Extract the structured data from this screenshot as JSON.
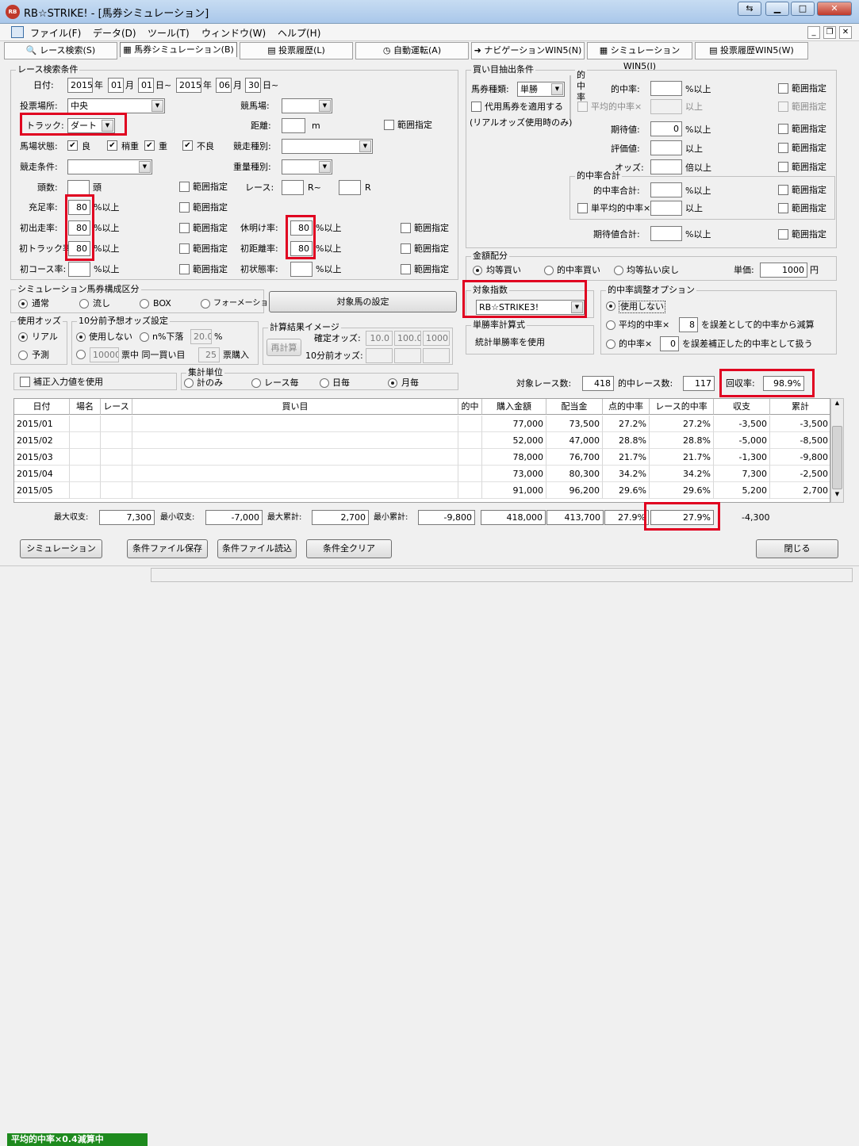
{
  "window": {
    "title": "RB☆STRIKE! - [馬券シミュレーション]",
    "app_icon": "RB"
  },
  "menu": [
    "ファイル(F)",
    "データ(D)",
    "ツール(T)",
    "ウィンドウ(W)",
    "ヘルプ(H)"
  ],
  "tabs": [
    "レース検索(S)",
    "馬券シミュレーション(B)",
    "投票履歴(L)",
    "自動運転(A)",
    "ナビゲーションWIN5(N)",
    "シミュレーションWIN5(I)",
    "投票履歴WIN5(W)"
  ],
  "race": {
    "group_title": "レース検索条件",
    "date_label": "日付:",
    "from_year": "2015",
    "year_u": "年",
    "from_month": "01",
    "month_u": "月",
    "from_day": "01",
    "day_u": "日~",
    "to_year": "2015",
    "to_month": "06",
    "to_day": "30",
    "venue_label": "投票場所:",
    "venue": "中央",
    "keibajo_label": "競馬場:",
    "track_label": "トラック:",
    "track": "ダート",
    "distance_label": "距離:",
    "distance_unit": "m",
    "range": "範囲指定",
    "baba_label": "馬場状態:",
    "baba_items": [
      "良",
      "稍重",
      "重",
      "不良"
    ],
    "shubetsu_label": "競走種別:",
    "jouken_label": "競走条件:",
    "juryo_label": "重量種別:",
    "tosu_label": "頭数:",
    "tosu_unit": "頭",
    "race_label": "レース:",
    "race_from_unit": "R~",
    "race_to_unit": "R",
    "rows": [
      {
        "label": "充足率:",
        "value": "80",
        "unit": "%以上"
      },
      {
        "label": "初出走率:",
        "value": "80",
        "unit": "%以上"
      },
      {
        "label": "初トラック率:",
        "value": "80",
        "unit": "%以上"
      },
      {
        "label": "初コース率:",
        "value": "",
        "unit": "%以上"
      }
    ],
    "rows2": [
      {
        "label": "休明け率:",
        "value": "80",
        "unit": "%以上"
      },
      {
        "label": "初距離率:",
        "value": "80",
        "unit": "%以上"
      },
      {
        "label": "初状態率:",
        "value": "",
        "unit": "%以上"
      }
    ]
  },
  "buy": {
    "group_title": "買い目抽出条件",
    "type_label": "馬券種類:",
    "type": "単勝",
    "daiyo": "代用馬券を適用する",
    "daiyo_note": "(リアルオッズ使用時のみ)",
    "hit_group": "的中率",
    "hit_label": "的中率:",
    "hit_unit": "%以上",
    "avg_hit_label": "平均的中率×",
    "avg_hit_unit": "以上",
    "exp_label": "期待値:",
    "exp_value": "0",
    "exp_unit": "%以上",
    "eval_label": "評価値:",
    "eval_unit": "以上",
    "odds_label": "オッズ:",
    "odds_unit": "倍以上",
    "sum_group": "的中率合計",
    "sum_label": "的中率合計:",
    "sum_unit": "%以上",
    "single_avg_label": "単平均的中率×",
    "single_avg_unit": "以上",
    "exp_sum_label": "期待値合計:",
    "exp_sum_unit": "%以上",
    "range": "範囲指定"
  },
  "money": {
    "group_title": "金額配分",
    "opts": [
      "均等買い",
      "的中率買い",
      "均等払い戻し"
    ],
    "unit_label": "単価:",
    "unit_value": "1000",
    "unit_yen": "円"
  },
  "sim": {
    "group_title": "シミュレーション馬券構成区分",
    "opts": [
      "通常",
      "流し",
      "BOX",
      "フォーメーション"
    ],
    "target_btn": "対象馬の設定"
  },
  "odds": {
    "group_title": "使用オッズ",
    "opts": [
      "リアル",
      "予測"
    ]
  },
  "pre10": {
    "group_title": "10分前予想オッズ設定",
    "not_use": "使用しない",
    "drop": "n%下落",
    "drop_value": "20.0",
    "drop_unit": "%",
    "ticket_value": "10000",
    "ticket_text": "票中 同一買い目",
    "buy_value": "25",
    "buy_unit": "票購入"
  },
  "calc_img": {
    "group_title": "計算結果イメージ",
    "recalc": "再計算",
    "fixed_label": "確定オッズ:",
    "fixed_vals": [
      "10.0",
      "100.0",
      "1000"
    ],
    "pre_label": "10分前オッズ:"
  },
  "target_index": {
    "group_title": "対象指数",
    "value": "RB☆STRIKE3!"
  },
  "single_calc": {
    "group_title": "単勝率計算式",
    "value": "統計単勝率を使用"
  },
  "adjust": {
    "group_title": "的中率調整オプション",
    "opt1": "使用しない",
    "opt2_pre": "平均的中率×",
    "opt2_value": "8",
    "opt2_post": "を誤差として的中率から減算",
    "opt3_pre": "的中率×",
    "opt3_value": "0",
    "opt3_post": "を誤差補正した的中率として扱う"
  },
  "correction": "補正入力値を使用",
  "agg": {
    "group_title": "集計単位",
    "opts": [
      "計のみ",
      "レース毎",
      "日毎",
      "月毎"
    ]
  },
  "summary": {
    "target_label": "対象レース数:",
    "target_value": "418",
    "hit_label": "的中レース数:",
    "hit_value": "117",
    "recovery_label": "回収率:",
    "recovery_value": "98.9%"
  },
  "table": {
    "headers": [
      "日付",
      "場名",
      "レース",
      "買い目",
      "的中",
      "購入金額",
      "配当金",
      "点的中率",
      "レース的中率",
      "収支",
      "累計"
    ],
    "rows": [
      [
        "2015/01",
        "",
        "",
        "",
        "",
        "77,000",
        "73,500",
        "27.2%",
        "27.2%",
        "-3,500",
        "-3,500"
      ],
      [
        "2015/02",
        "",
        "",
        "",
        "",
        "52,000",
        "47,000",
        "28.8%",
        "28.8%",
        "-5,000",
        "-8,500"
      ],
      [
        "2015/03",
        "",
        "",
        "",
        "",
        "78,000",
        "76,700",
        "21.7%",
        "21.7%",
        "-1,300",
        "-9,800"
      ],
      [
        "2015/04",
        "",
        "",
        "",
        "",
        "73,000",
        "80,300",
        "34.2%",
        "34.2%",
        "7,300",
        "-2,500"
      ],
      [
        "2015/05",
        "",
        "",
        "",
        "",
        "91,000",
        "96,200",
        "29.6%",
        "29.6%",
        "5,200",
        "2,700"
      ]
    ]
  },
  "footer": {
    "max_balance_label": "最大収支:",
    "max_balance": "7,300",
    "min_balance_label": "最小収支:",
    "min_balance": "-7,000",
    "max_cum_label": "最大累計:",
    "max_cum": "2,700",
    "min_cum_label": "最小累計:",
    "min_cum": "-9,800",
    "total_buy": "418,000",
    "total_pay": "413,700",
    "pt_hit": "27.9%",
    "race_hit": "27.9%",
    "balance": "-4,300"
  },
  "buttons": {
    "sim": "シミュレーション",
    "save": "条件ファイル保存",
    "load": "条件ファイル読込",
    "clear": "条件全クリア",
    "close": "閉じる"
  },
  "status": "平均的中率×0.4減算中"
}
